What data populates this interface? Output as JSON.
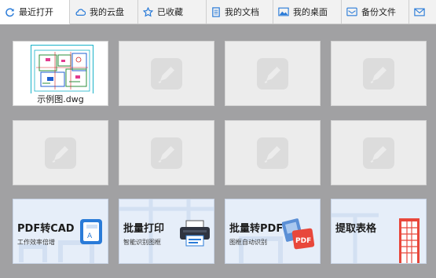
{
  "tabs": [
    {
      "label": "最近打开",
      "icon": "refresh-icon",
      "active": true
    },
    {
      "label": "我的云盘",
      "icon": "cloud-icon"
    },
    {
      "label": "已收藏",
      "icon": "star-icon"
    },
    {
      "label": "我的文档",
      "icon": "document-icon"
    },
    {
      "label": "我的桌面",
      "icon": "desktop-image-icon"
    },
    {
      "label": "备份文件",
      "icon": "backup-folder-icon"
    },
    {
      "label": "",
      "icon": "mail-icon"
    }
  ],
  "recent_files": [
    {
      "name": "示例图.dwg",
      "has_thumbnail": true
    }
  ],
  "placeholder_icon": "pencil-placeholder-icon",
  "tools": [
    {
      "title": "PDF转CAD",
      "subtitle": "工作效率倍增",
      "icon": "pdf-to-cad-icon"
    },
    {
      "title": "批量打印",
      "subtitle": "智能识别图框",
      "icon": "printer-icon"
    },
    {
      "title": "批量转PDF",
      "subtitle": "图框自动识别",
      "icon": "pdf-badge-icon"
    },
    {
      "title": "提取表格",
      "subtitle": "",
      "icon": "table-extract-icon"
    }
  ],
  "colors": {
    "accent": "#2a7bd8",
    "tool_bg": "#e6eef9",
    "pdf_red": "#e8473b"
  }
}
